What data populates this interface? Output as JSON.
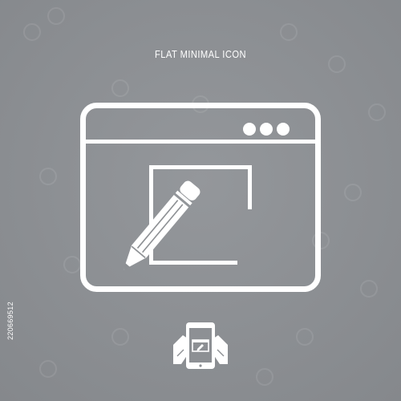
{
  "header": {
    "title": "FLAT MINIMAL ICON"
  },
  "main_icon": {
    "icon": "browser-window-edit-icon",
    "window_control_dots": 3
  },
  "mini_icon": {
    "icon": "tablet-hands-icon"
  },
  "image_id": "220669512",
  "colors": {
    "background": "#8d9094",
    "foreground": "#ffffff"
  }
}
